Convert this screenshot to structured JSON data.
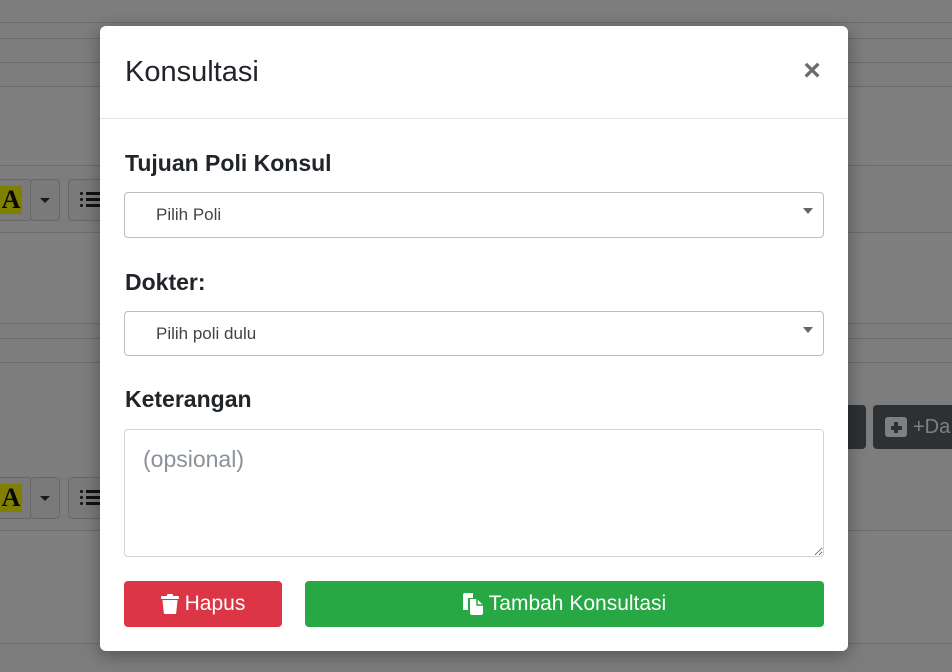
{
  "modal": {
    "title": "Konsultasi",
    "close_glyph": "×",
    "fields": {
      "poli_label": "Tujuan Poli Konsul",
      "poli_value": "Pilih Poli",
      "dokter_label": "Dokter:",
      "dokter_value": "Pilih poli dulu",
      "keterangan_label": "Keterangan",
      "keterangan_placeholder": "(opsional)"
    },
    "buttons": {
      "delete_label": "Hapus",
      "add_label": "Tambah Konsultasi"
    },
    "icons": {
      "close": "close-icon",
      "delete": "trash-icon",
      "add": "copy-icon"
    }
  },
  "background": {
    "font_color_glyph": "A",
    "add_button_label": "+Da"
  },
  "colors": {
    "danger": "#dc3545",
    "success": "#28a745",
    "overlay": "rgba(0,0,0,0.5)"
  }
}
